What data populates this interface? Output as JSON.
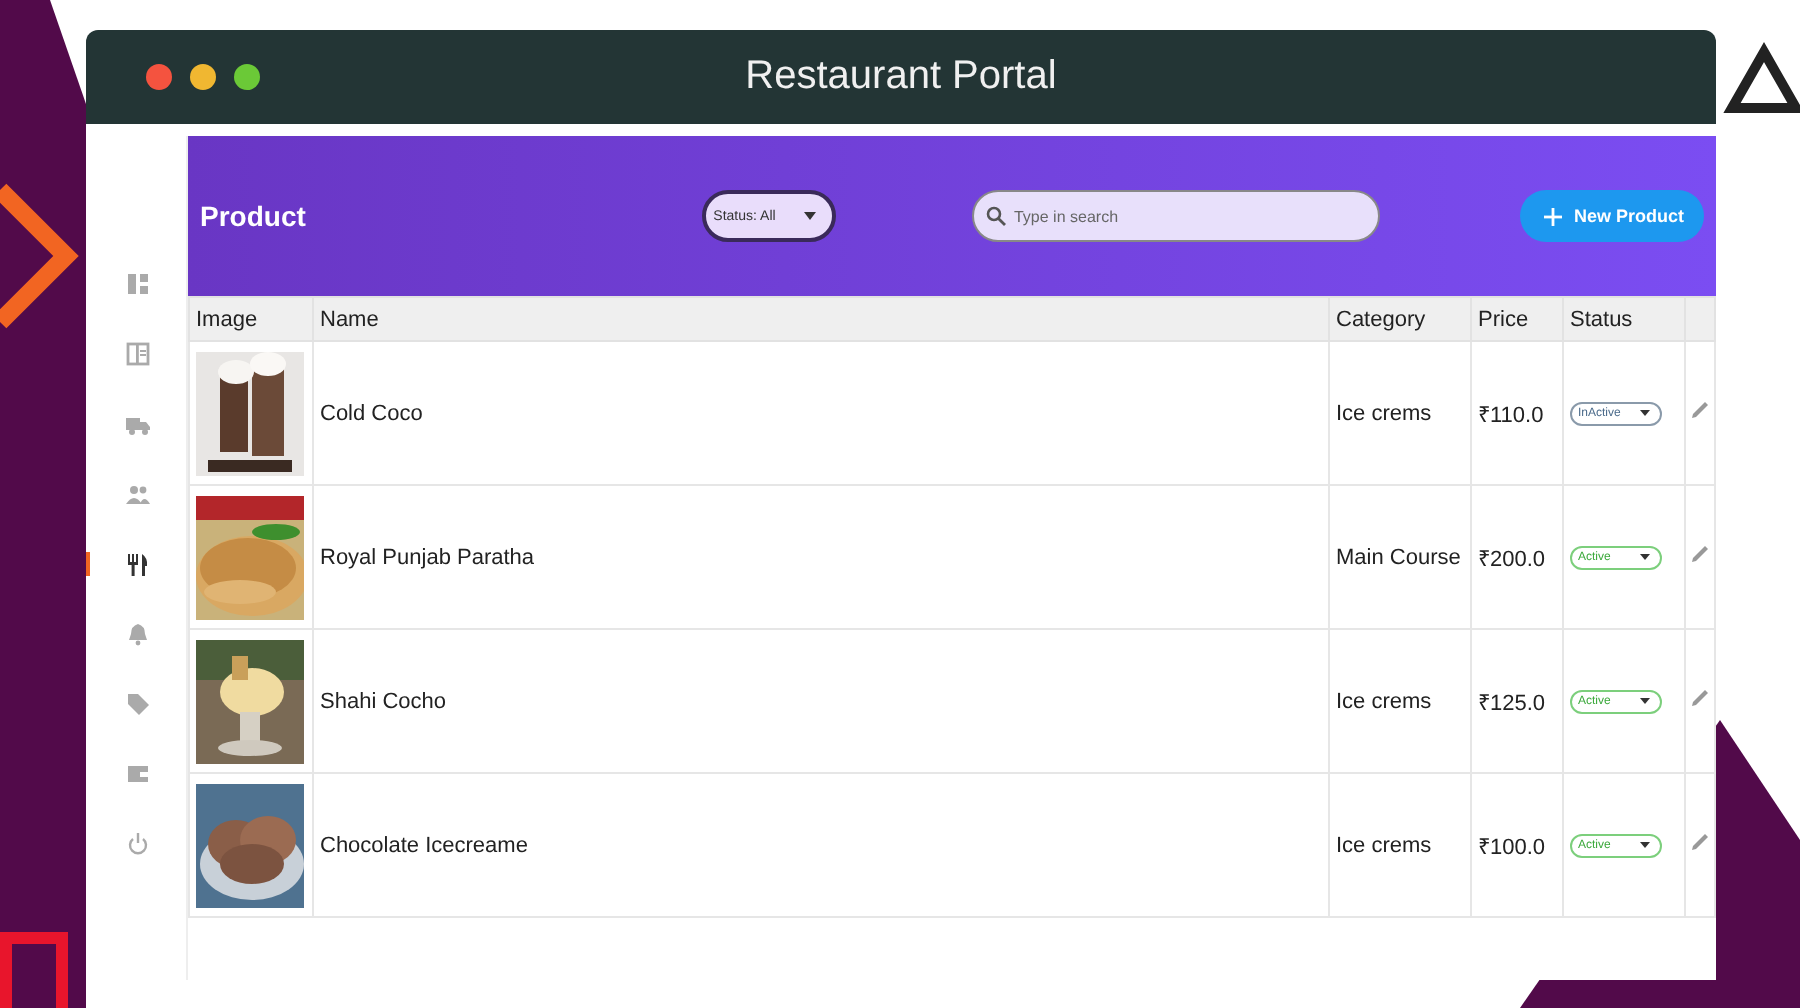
{
  "window": {
    "title": "Restaurant Portal"
  },
  "sidebar": {
    "items": [
      {
        "selected": false
      },
      {
        "selected": false
      },
      {
        "selected": false
      },
      {
        "selected": false
      },
      {
        "selected": true
      },
      {
        "selected": false
      },
      {
        "selected": false
      },
      {
        "selected": false
      },
      {
        "selected": false
      }
    ]
  },
  "header": {
    "title": "Product",
    "status_filter": "Status: All",
    "search": {
      "placeholder": "Type in search"
    },
    "new_button": "New Product"
  },
  "table": {
    "columns": [
      "Image",
      "Name",
      "Category",
      "Price",
      "Status"
    ],
    "rows": [
      {
        "name": "Cold Coco",
        "category": "Ice crems",
        "price": "₹110.0",
        "status": "InActive",
        "active": false
      },
      {
        "name": "Royal Punjab Paratha",
        "category": "Main Course",
        "price": "₹200.0",
        "status": "Active",
        "active": true
      },
      {
        "name": "Shahi Cocho",
        "category": "Ice crems",
        "price": "₹125.0",
        "status": "Active",
        "active": true
      },
      {
        "name": "Chocolate Icecreame",
        "category": "Ice crems",
        "price": "₹100.0",
        "status": "Active",
        "active": true
      }
    ]
  }
}
